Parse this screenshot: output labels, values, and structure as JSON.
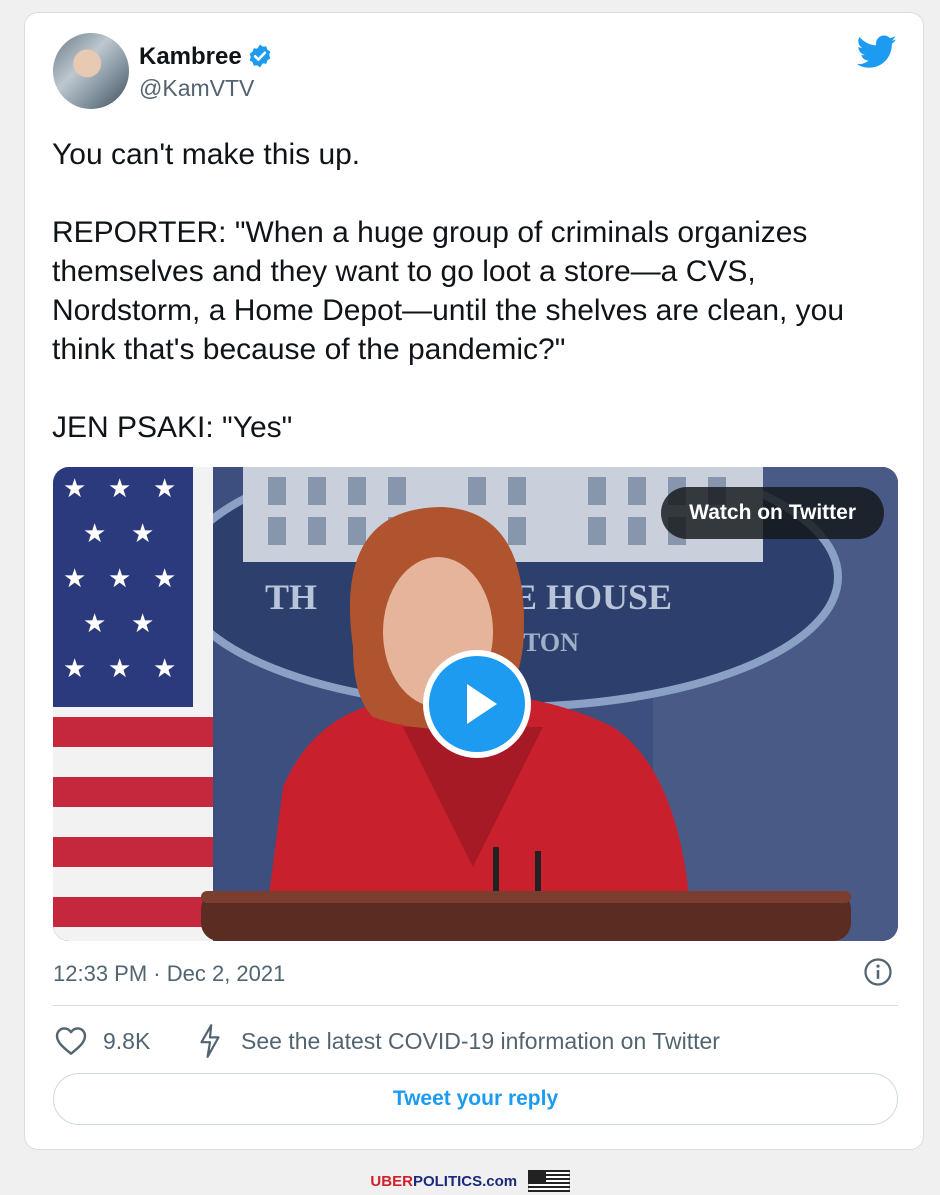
{
  "tweet": {
    "author_name": "Kambree",
    "handle": "@KamVTV",
    "text": "You can't make this up.\n\nREPORTER: \"When a huge group of criminals organizes themselves and they want to go loot a store—a CVS, Nordstorm, a Home Depot—until the shelves are clean, you think that's because of the pandemic?\"\n\nJEN PSAKI: \"Yes\"",
    "timestamp": "12:33 PM · Dec 2, 2021",
    "like_count": "9.8K",
    "covid_link": "See the latest COVID-19 information on Twitter"
  },
  "media": {
    "watch_label": "Watch on Twitter",
    "backdrop_text_1": "TH",
    "backdrop_text_2": "E HOUSE",
    "backdrop_text_3": "TON"
  },
  "actions": {
    "reply_label": "Tweet your reply"
  },
  "watermark": {
    "brand_1": "UBER",
    "brand_2": "POLITICS",
    "brand_3": ".com"
  },
  "icons": {
    "verified": "verified-badge-icon",
    "logo": "twitter-bird-icon",
    "play": "play-icon",
    "info": "info-icon",
    "like": "heart-icon",
    "covid": "bolt-icon"
  },
  "colors": {
    "accent": "#1d9bf0",
    "text": "#0f1419",
    "muted": "#536471"
  }
}
